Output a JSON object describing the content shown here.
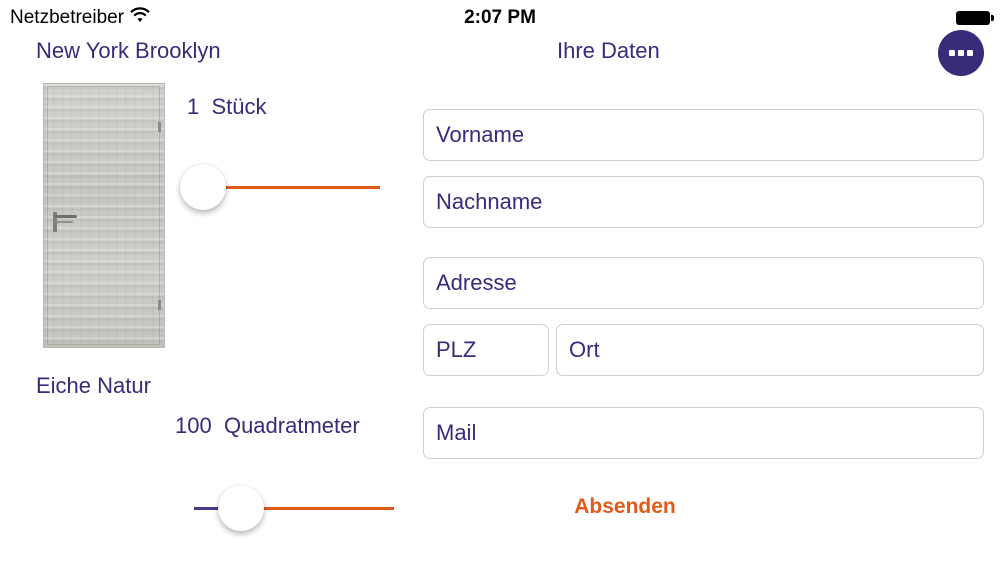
{
  "status_bar": {
    "carrier": "Netzbetreiber",
    "time": "2:07 PM",
    "wifi_icon": "wifi-icon",
    "battery_icon": "battery-icon"
  },
  "product": {
    "name": "New York Brooklyn",
    "quantity_value": "1",
    "quantity_unit": "Stück",
    "finish": "Eiche Natur",
    "area_value": "100",
    "area_unit": "Quadratmeter",
    "image_icon": "door-image"
  },
  "sliders": {
    "quantity": {
      "fraction": 0.0
    },
    "area": {
      "fraction": 0.07
    }
  },
  "form": {
    "title": "Ihre Daten",
    "menu_icon": "more-icon",
    "fields": {
      "vorname": {
        "placeholder": "Vorname",
        "value": ""
      },
      "nachname": {
        "placeholder": "Nachname",
        "value": ""
      },
      "adresse": {
        "placeholder": "Adresse",
        "value": ""
      },
      "plz": {
        "placeholder": "PLZ",
        "value": ""
      },
      "ort": {
        "placeholder": "Ort",
        "value": ""
      },
      "mail": {
        "placeholder": "Mail",
        "value": ""
      }
    },
    "submit_label": "Absenden"
  },
  "colors": {
    "brand_purple": "#3a2a7a",
    "accent_orange": "#e05a18"
  }
}
